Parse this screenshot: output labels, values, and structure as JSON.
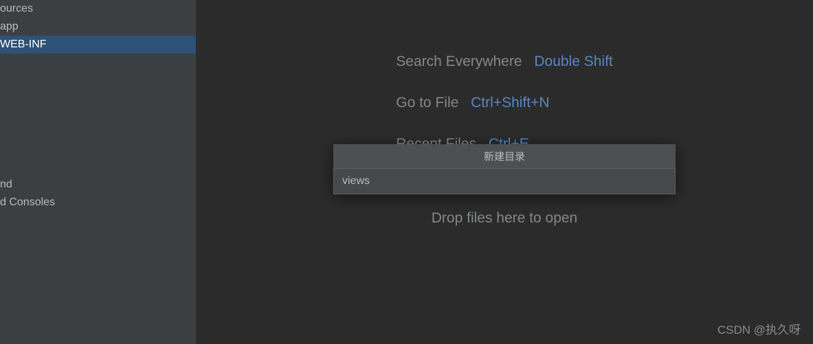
{
  "sidebar": {
    "items": [
      {
        "label": "ources",
        "selected": false
      },
      {
        "label": "app",
        "selected": false
      },
      {
        "label": "WEB-INF",
        "selected": true
      }
    ],
    "lower_items": [
      {
        "label": ""
      },
      {
        "label": "nd"
      },
      {
        "label": "d Consoles"
      }
    ]
  },
  "hints": {
    "search": {
      "label": "Search Everywhere",
      "key": "Double Shift"
    },
    "gotofile": {
      "label": "Go to File",
      "key": "Ctrl+Shift+N"
    },
    "recent": {
      "label": "Recent Files",
      "key": "Ctrl+E"
    },
    "drop": "Drop files here to open"
  },
  "dialog": {
    "title": "新建目录",
    "input_value": "views"
  },
  "watermark": "CSDN @执久呀"
}
